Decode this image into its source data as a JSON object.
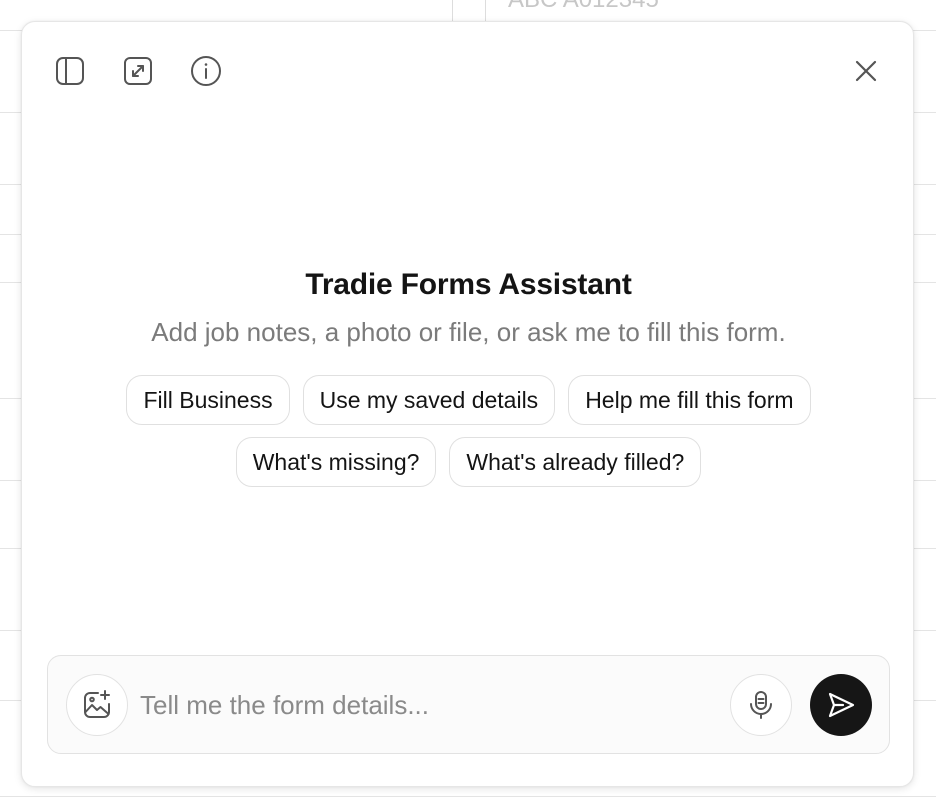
{
  "background": {
    "partial_text": "ABC A012345"
  },
  "assistant": {
    "title": "Tradie Forms Assistant",
    "subtitle": "Add job notes, a photo or file, or ask me to fill this form.",
    "suggestions_row1": [
      "Fill Business",
      "Use my saved details",
      "Help me fill this form"
    ],
    "suggestions_row2": [
      "What's missing?",
      "What's already filled?"
    ]
  },
  "toolbar": {
    "icons": [
      "sidebar-icon",
      "expand-icon",
      "info-icon",
      "close-icon"
    ]
  },
  "composer": {
    "value": "",
    "placeholder": "Tell me the form details...",
    "icons": [
      "add-image-icon",
      "microphone-icon",
      "send-icon"
    ]
  },
  "colors": {
    "send_button": "#161616",
    "placeholder": "#8a8a8a",
    "subtitle": "#7b7b7b",
    "border": "#e2e2e2"
  }
}
